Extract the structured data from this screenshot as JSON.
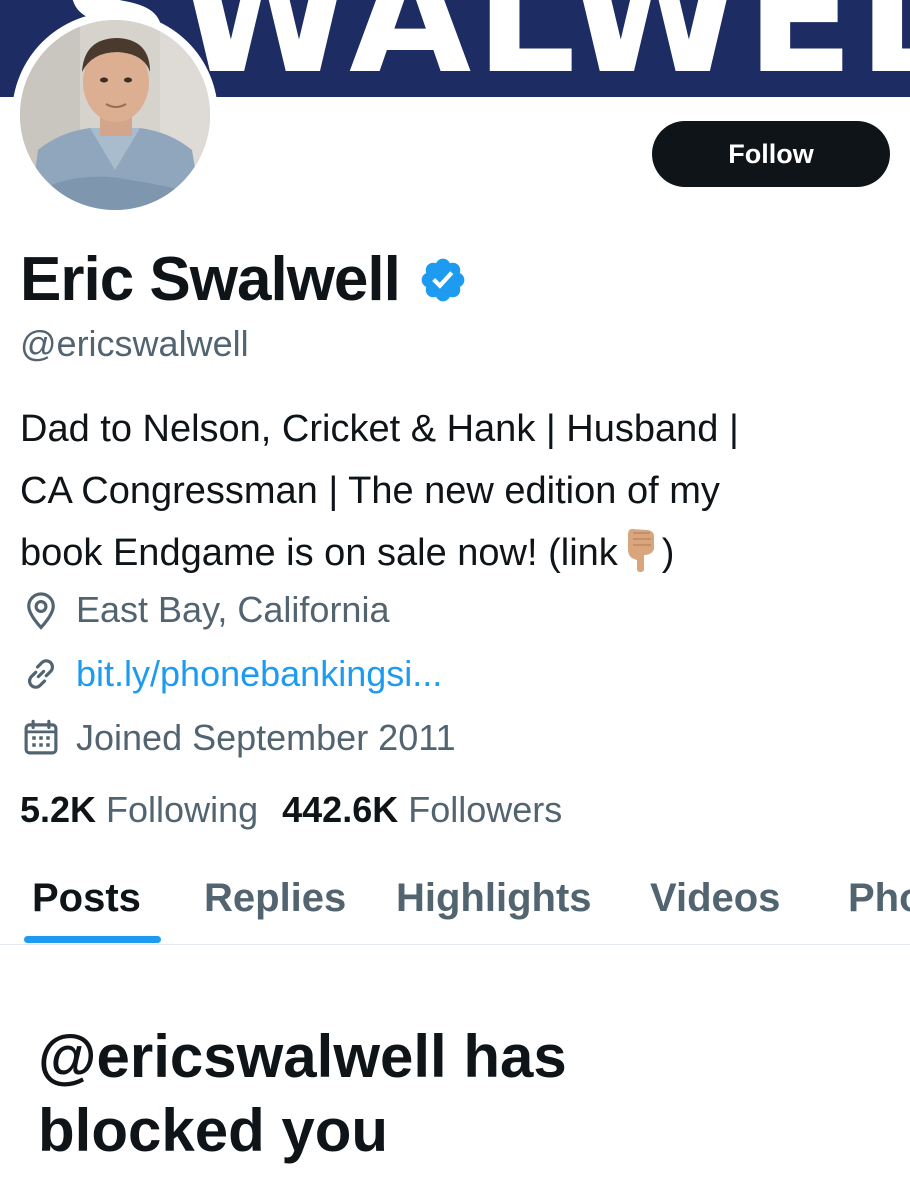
{
  "banner": {
    "text": "SWALWELL",
    "background": "#1d2d64"
  },
  "avatar": {
    "alt": "profile photo"
  },
  "follow_button": {
    "label": "Follow"
  },
  "profile": {
    "display_name": "Eric Swalwell",
    "verified_icon": "verified-badge-icon",
    "handle": "@ericswalwell",
    "bio_lines": [
      "Dad to Nelson, Cricket & Hank | Husband |",
      "CA Congressman | The new edition of my",
      "book Endgame is on sale now! (link",
      ")"
    ],
    "bio_emoji": "pointing-down-hand-icon",
    "location": "East Bay, California",
    "website": "bit.ly/phonebankingsi...",
    "joined": "Joined September 2011"
  },
  "stats": {
    "following_count": "5.2K",
    "following_label": "Following",
    "followers_count": "442.6K",
    "followers_label": "Followers"
  },
  "tabs": [
    {
      "label": "Posts",
      "active": true
    },
    {
      "label": "Replies",
      "active": false
    },
    {
      "label": "Highlights",
      "active": false
    },
    {
      "label": "Videos",
      "active": false
    },
    {
      "label": "Photos",
      "active": false
    }
  ],
  "blocked_message": {
    "line1": "@ericswalwell has",
    "line2": "blocked you"
  },
  "colors": {
    "accent": "#1d9bf0",
    "text_primary": "#0f1419",
    "text_secondary": "#536471",
    "button_bg": "#0f1419"
  }
}
